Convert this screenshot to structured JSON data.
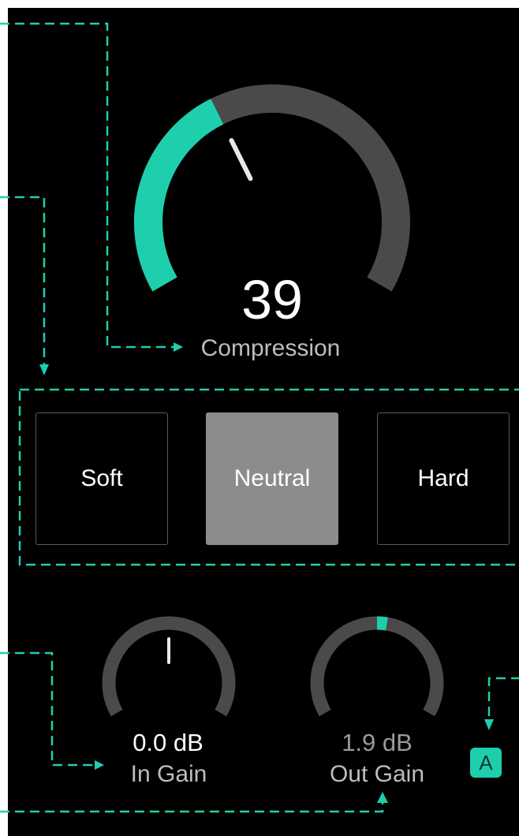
{
  "compression": {
    "value": "39",
    "label": "Compression",
    "fraction": 0.39
  },
  "modes": {
    "options": [
      "Soft",
      "Neutral",
      "Hard"
    ],
    "selected": "Neutral"
  },
  "in_gain": {
    "value": "0.0 dB",
    "label": "In Gain",
    "db": 0.0
  },
  "out_gain": {
    "value": "1.9 dB",
    "label": "Out Gain",
    "db": 1.9
  },
  "auto_button": {
    "label": "A"
  },
  "colors": {
    "accent": "#1ecfad",
    "track": "#4a4a4a",
    "panel_bg": "#000000",
    "active_button": "#8c8c8c",
    "callout": "#1ecfad"
  }
}
